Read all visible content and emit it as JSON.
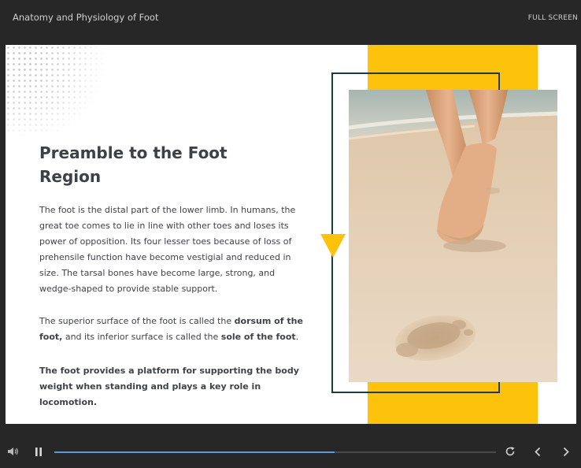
{
  "app": {
    "course_title": "Anatomy and Physiology of Foot",
    "fullscreen_label": "FULL SCREEN"
  },
  "slide": {
    "heading": "Preamble to the Foot Region",
    "paragraph1": "The foot is the distal part of the lower limb. In humans, the great toe comes to lie in line with other toes and loses its power of opposition. Its four lesser toes because of loss of prehensile function have become vestigial and reduced in size. The tarsal bones have become large, strong, and wedge-shaped to provide stable support.",
    "paragraph2": {
      "part1": "The superior surface of the foot is called the ",
      "bold1": "dorsum of the foot,",
      "part2": " and its inferior surface is called the ",
      "bold2": "sole of the foot",
      "part3": "."
    },
    "paragraph3": "The foot provides a platform for supporting the body weight when standing and plays a key role in locomotion.",
    "accent_color": "#fdc20b",
    "frame_color": "#1e3a48",
    "image_subject": "bare feet walking on sand with a footprint"
  },
  "player": {
    "progress_fraction": 0.635,
    "progress_color": "#5d9ad6",
    "icons": [
      "volume-icon",
      "pause-icon",
      "replay-icon",
      "prev-icon",
      "next-icon"
    ]
  }
}
